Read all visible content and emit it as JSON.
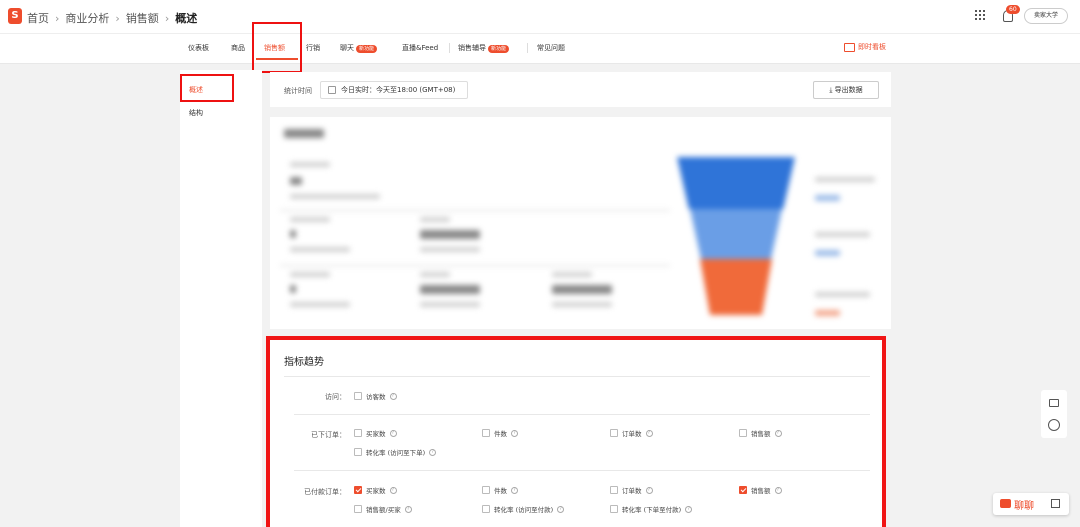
{
  "breadcrumb": {
    "home": "首页",
    "seg1": "商业分析",
    "seg2": "销售额",
    "current": "概述",
    "sep": "›"
  },
  "header": {
    "logo": "S",
    "notification_count": "60",
    "user": "卖家大学"
  },
  "nav": {
    "tabs": [
      {
        "label": "仪表板"
      },
      {
        "label": "商品"
      },
      {
        "label": "销售额"
      },
      {
        "label": "行销"
      },
      {
        "label": "聊天",
        "badge": "新功能"
      },
      {
        "label": "直播&Feed"
      },
      {
        "label": "销售辅导",
        "badge": "新功能"
      },
      {
        "label": "常见问题"
      }
    ],
    "live_tool": "即时看板"
  },
  "sidebar": {
    "items": [
      {
        "label": "概述"
      },
      {
        "label": "结构"
      }
    ]
  },
  "time_bar": {
    "label": "统计时间",
    "value": "今日实时：今天至18:00 (GMT+08)",
    "export": "导出数据"
  },
  "trend": {
    "title": "指标趋势",
    "rows": [
      {
        "label": "访问：",
        "options": [
          {
            "text": "访客数",
            "checked": false
          }
        ]
      },
      {
        "label": "已下订单：",
        "options": [
          {
            "text": "买家数",
            "checked": false
          },
          {
            "text": "件数",
            "checked": false
          },
          {
            "text": "订单数",
            "checked": false
          },
          {
            "text": "销售额",
            "checked": false
          },
          {
            "text": "转化率 (访问至下单)",
            "checked": false
          }
        ]
      },
      {
        "label": "已付款订单：",
        "options": [
          {
            "text": "买家数",
            "checked": true
          },
          {
            "text": "件数",
            "checked": false
          },
          {
            "text": "订单数",
            "checked": false
          },
          {
            "text": "销售额",
            "checked": true
          },
          {
            "text": "销售额/买家",
            "checked": false
          },
          {
            "text": "转化率 (访问至付款)",
            "checked": false
          },
          {
            "text": "转化率 (下单至付款)",
            "checked": false
          }
        ]
      }
    ],
    "help": "?"
  },
  "chat": {
    "label": "聊聊"
  }
}
